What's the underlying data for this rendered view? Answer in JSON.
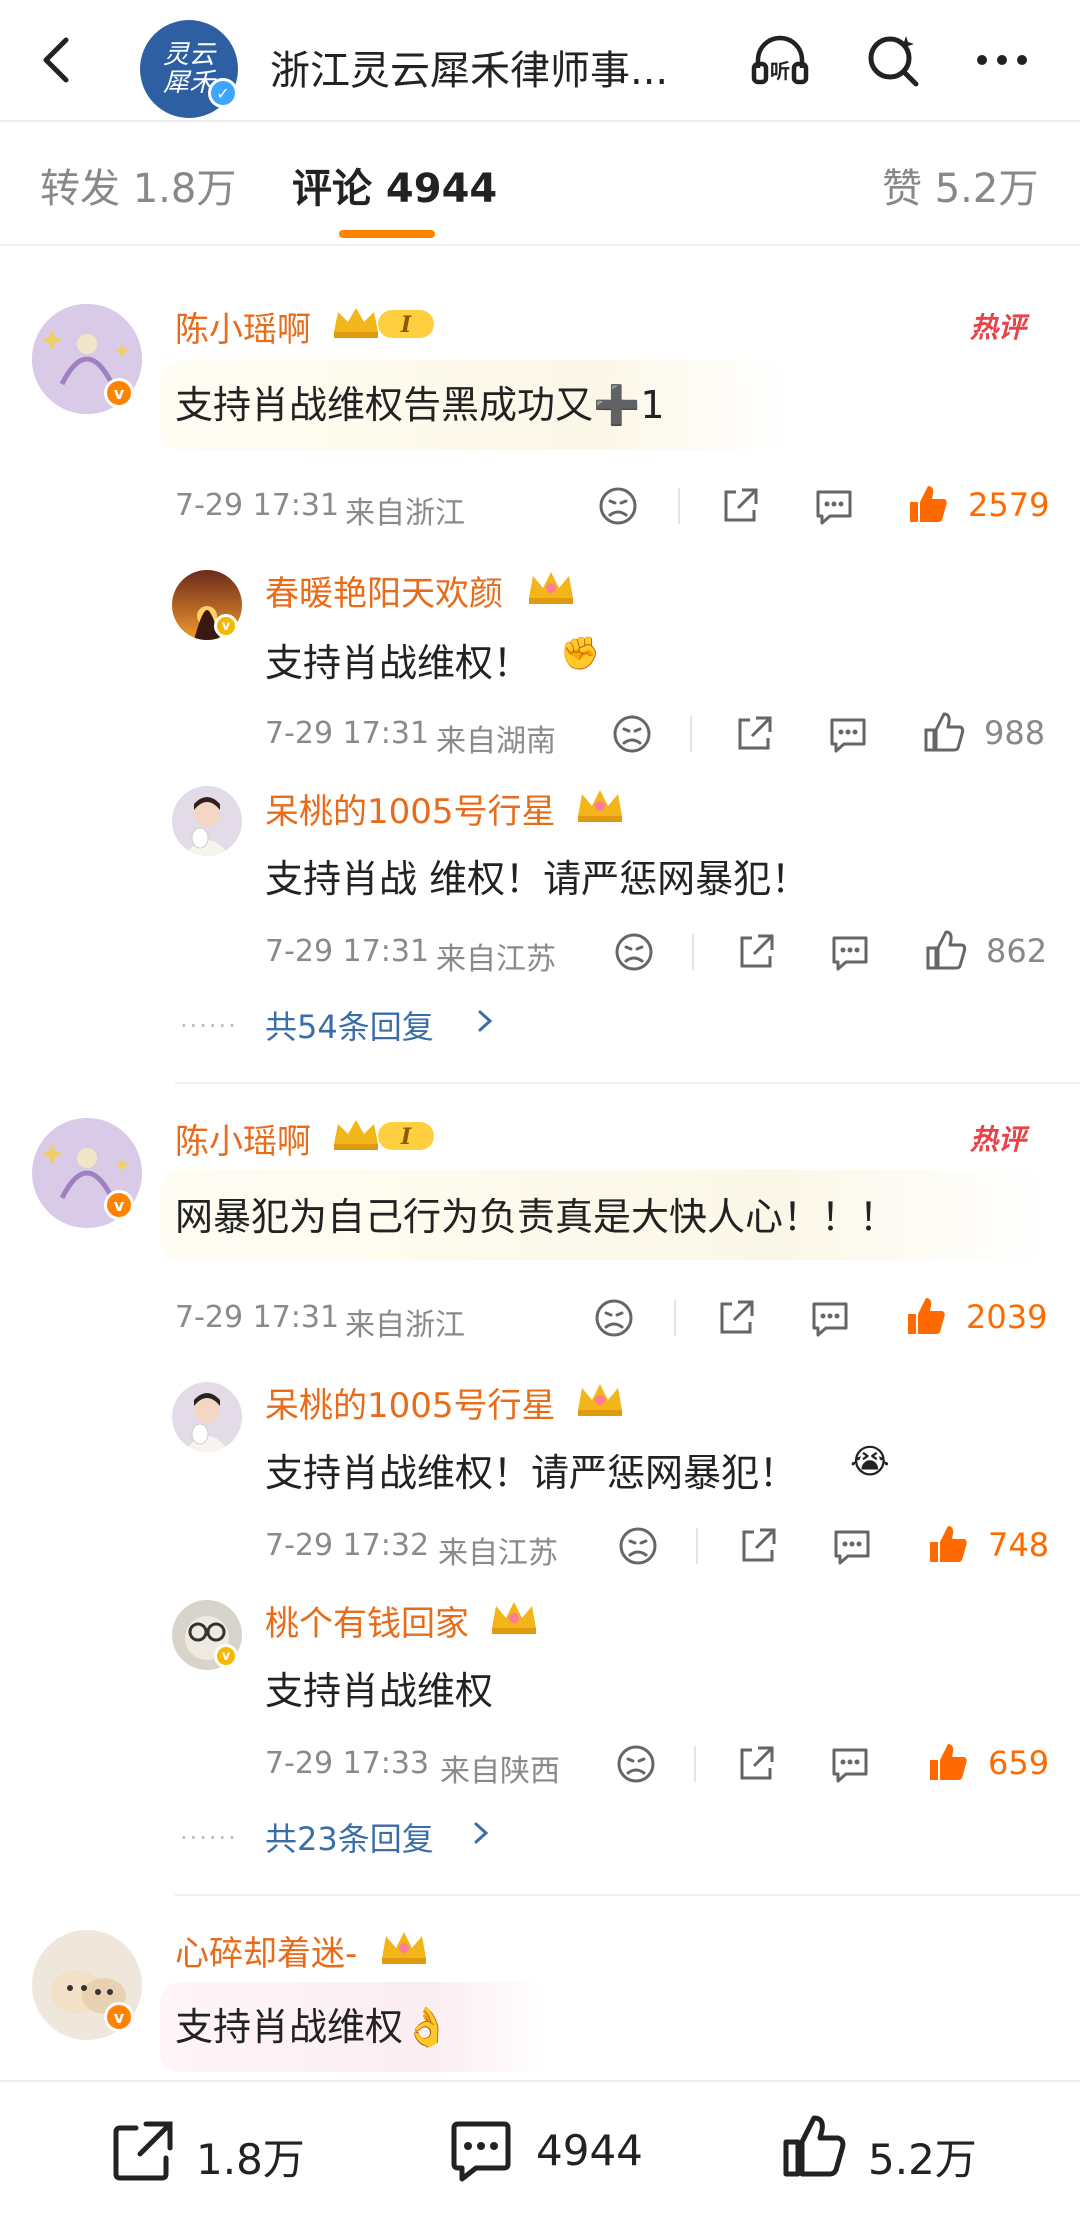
{
  "header": {
    "title": "浙江灵云犀禾律师事...",
    "logo_text": "灵云犀禾",
    "icons": [
      "back-icon",
      "listen-icon",
      "search-icon",
      "more-icon"
    ]
  },
  "tabs": {
    "repost": "转发 1.8万",
    "comments": "评论 4944",
    "likes": "赞 5.2万"
  },
  "hot_label": "热评",
  "comments": [
    {
      "user": "陈小瑶啊",
      "level": "I",
      "text": "支持肖战维权告黑成功又➕1",
      "time": "7-29 17:31",
      "location": "来自浙江",
      "likes": "2579",
      "hot": true,
      "replies": [
        {
          "user": "春暖艳阳天欢颜",
          "text": "支持肖战维权！",
          "time": "7-29 17:31",
          "location": "来自湖南",
          "likes": "988"
        },
        {
          "user": "呆桃的1005号行星",
          "text": "支持肖战 维权！请严惩网暴犯！",
          "time": "7-29 17:31",
          "location": "来自江苏",
          "likes": "862"
        }
      ],
      "more_replies": "共54条回复"
    },
    {
      "user": "陈小瑶啊",
      "level": "I",
      "text": "网暴犯为自己行为负责真是大快人心！！！",
      "time": "7-29 17:31",
      "location": "来自浙江",
      "likes": "2039",
      "hot": true,
      "replies": [
        {
          "user": "呆桃的1005号行星",
          "text": "支持肖战维权！请严惩网暴犯！",
          "time": "7-29 17:32",
          "location": "来自江苏",
          "likes": "748"
        },
        {
          "user": "桃个有钱回家",
          "text": "支持肖战维权",
          "time": "7-29 17:33",
          "location": "来自陕西",
          "likes": "659"
        }
      ],
      "more_replies": "共23条回复"
    },
    {
      "user": "心碎却着迷-",
      "text": "支持肖战维权👌"
    }
  ],
  "bottom_bar": {
    "repost": "1.8万",
    "comments": "4944",
    "likes": "5.2万"
  },
  "colors": {
    "accent": "#ff8200",
    "username": "#e86b1a",
    "hot_like": "#ff6a00",
    "link": "#3a6ea8",
    "hot_badge": "#e8434b"
  }
}
